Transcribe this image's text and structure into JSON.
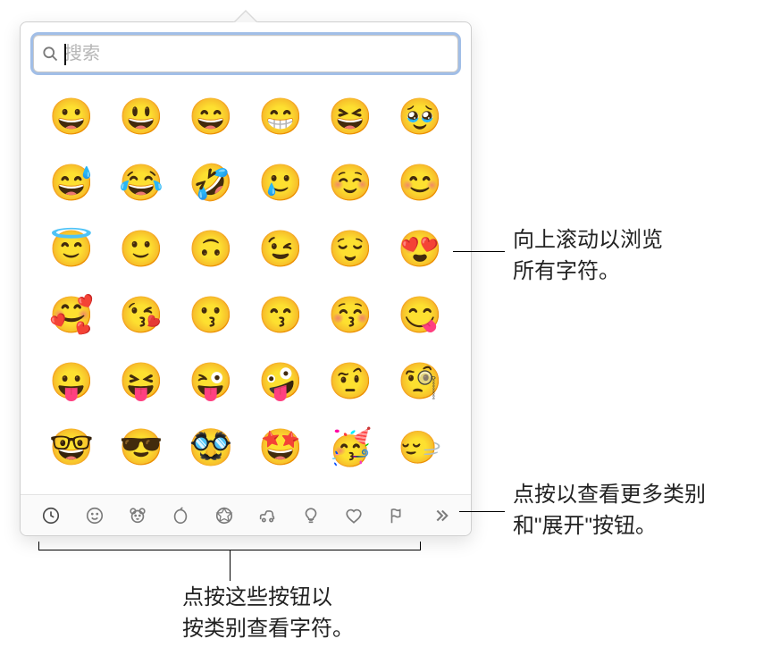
{
  "search": {
    "placeholder": "搜索",
    "value": ""
  },
  "emojis": [
    "😀",
    "😃",
    "😄",
    "😁",
    "😆",
    "🥹",
    "😅",
    "😂",
    "🤣",
    "🥲",
    "☺️",
    "😊",
    "😇",
    "🙂",
    "🙃",
    "😉",
    "😌",
    "😍",
    "🥰",
    "😘",
    "😗",
    "😙",
    "😚",
    "😋",
    "😛",
    "😝",
    "😜",
    "🤪",
    "🤨",
    "🧐",
    "🤓",
    "😎",
    "🥸",
    "🤩",
    "🥳",
    "🙂‍↔️"
  ],
  "categories": [
    {
      "id": "frequently-used",
      "label": "常用",
      "selected": true
    },
    {
      "id": "smileys",
      "label": "表情与人物",
      "selected": false
    },
    {
      "id": "animals",
      "label": "动物与自然",
      "selected": false
    },
    {
      "id": "food",
      "label": "食物与饮料",
      "selected": false
    },
    {
      "id": "activity",
      "label": "活动",
      "selected": false
    },
    {
      "id": "travel",
      "label": "旅行与地点",
      "selected": false
    },
    {
      "id": "objects",
      "label": "物品",
      "selected": false
    },
    {
      "id": "symbols",
      "label": "符号",
      "selected": false
    },
    {
      "id": "flags",
      "label": "旗帜",
      "selected": false
    },
    {
      "id": "more",
      "label": "更多",
      "selected": false
    }
  ],
  "callouts": {
    "scroll_up": "向上滚动以浏览\n所有字符。",
    "more_categories": "点按以查看更多类别\n和\"展开\"按钮。",
    "category_buttons": "点按这些按钮以\n按类别查看字符。"
  }
}
